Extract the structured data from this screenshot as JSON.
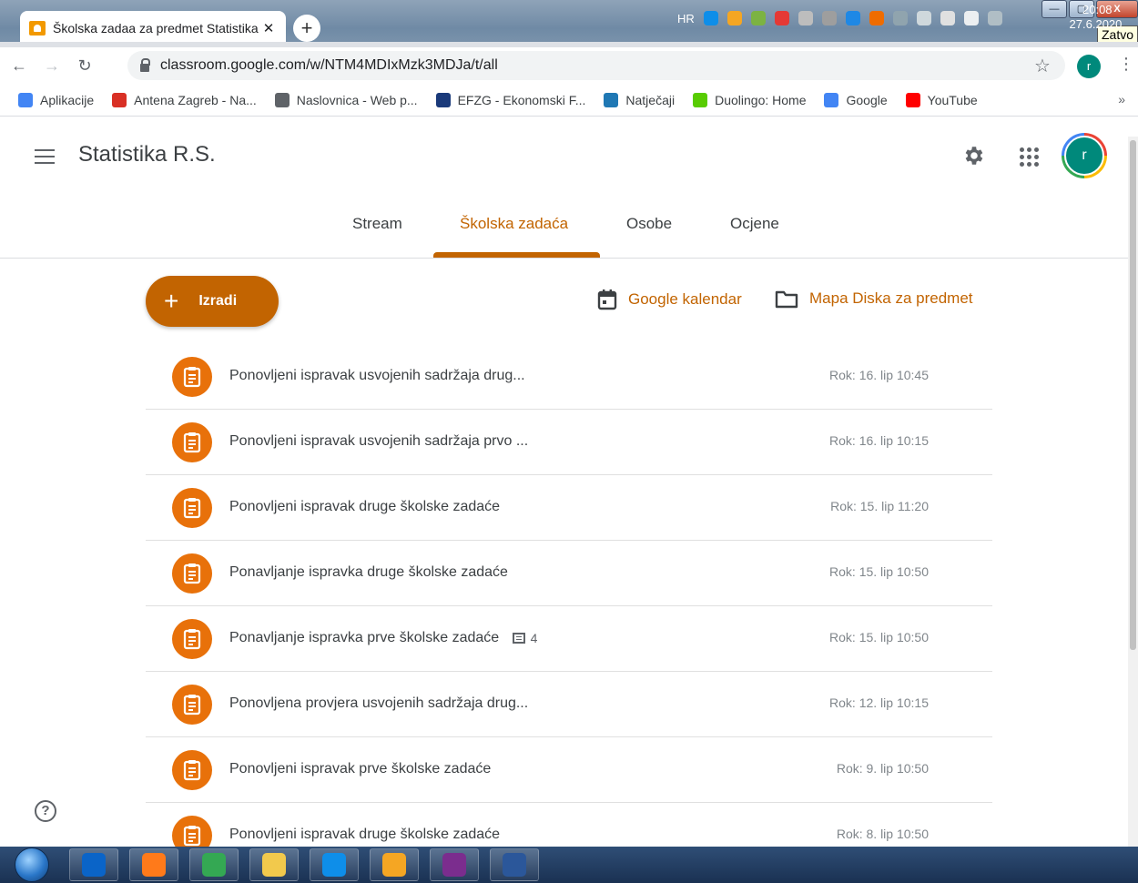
{
  "browser": {
    "tab_title": "Školska zadaa za predmet Statistika",
    "tab_close": "✕",
    "new_tab": "+",
    "url": "classroom.google.com/w/NTM4MDIxMzk3MDJa/t/all",
    "profile_initial": "r",
    "window_buttons": {
      "minimize": "—",
      "maximize": "▢",
      "close": "X"
    },
    "close_tooltip": "Zatvo",
    "bookmarks": [
      {
        "label": "Aplikacije",
        "color": "#4285f4"
      },
      {
        "label": "Antena Zagreb - Na...",
        "color": "#d93025"
      },
      {
        "label": "Naslovnica - Web p...",
        "color": "#5f6368"
      },
      {
        "label": "EFZG - Ekonomski F...",
        "color": "#1a3a7a"
      },
      {
        "label": "Natječaji",
        "color": "#1f78b4"
      },
      {
        "label": "Duolingo: Home",
        "color": "#58cc02"
      },
      {
        "label": "Google",
        "color": "#4285f4"
      },
      {
        "label": "YouTube",
        "color": "#ff0000"
      }
    ],
    "bookmarks_more": "»"
  },
  "app": {
    "class_title": "Statistika R.S.",
    "avatar_initial": "r",
    "accent_color": "#c26401",
    "tabs": [
      {
        "label": "Stream"
      },
      {
        "label": "Školska zadaća",
        "active": true
      },
      {
        "label": "Osobe"
      },
      {
        "label": "Ocjene"
      }
    ],
    "create_button": {
      "icon": "+",
      "label": "Izradi"
    },
    "calendar_link": "Google kalendar",
    "drive_link": "Mapa Diska za predmet",
    "help": "?"
  },
  "assignments": [
    {
      "title": "Ponovljeni ispravak usvojenih sadržaja drug...",
      "due": "Rok: 16. lip 10:45"
    },
    {
      "title": "Ponovljeni ispravak usvojenih sadržaja prvo ...",
      "due": "Rok: 16. lip 10:15"
    },
    {
      "title": "Ponovljeni ispravak druge školske zadaće",
      "due": "Rok: 15. lip 11:20"
    },
    {
      "title": "Ponavljanje ispravka druge školske zadaće",
      "due": "Rok: 15. lip 10:50"
    },
    {
      "title": "Ponavljanje ispravka prve školske zadaće",
      "comments": "4",
      "due": "Rok: 15. lip 10:50"
    },
    {
      "title": "Ponovljena provjera usvojenih sadržaja drug...",
      "due": "Rok: 12. lip 10:15"
    },
    {
      "title": "Ponovljeni ispravak prve školske zadaće",
      "due": "Rok: 9. lip 10:50"
    },
    {
      "title": "Ponovljeni ispravak druge školske zadaće",
      "due": "Rok: 8. lip 10:50"
    }
  ],
  "taskbar": {
    "apps": [
      {
        "name": "outlook",
        "color": "#0a64c8"
      },
      {
        "name": "firefox",
        "color": "#ff7a1a"
      },
      {
        "name": "chrome",
        "color": "#34a853"
      },
      {
        "name": "explorer",
        "color": "#f2c94c"
      },
      {
        "name": "teamviewer",
        "color": "#0e8ee9"
      },
      {
        "name": "settings",
        "color": "#f5a623"
      },
      {
        "name": "winrar",
        "color": "#7b2d8e"
      },
      {
        "name": "word",
        "color": "#2b579a"
      }
    ],
    "language": "HR",
    "time": "20:08",
    "date": "27.6.2020."
  }
}
